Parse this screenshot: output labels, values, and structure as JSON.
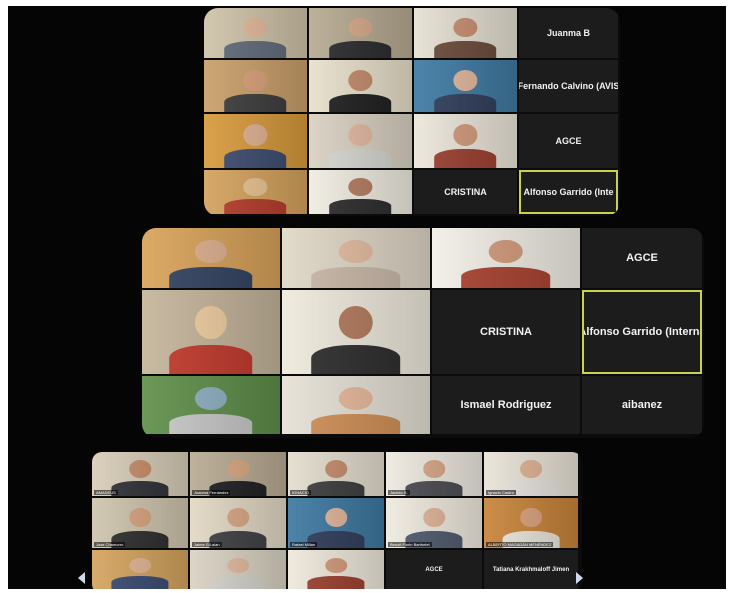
{
  "panels": [
    {
      "tiles": [
        {
          "kind": "video",
          "bg": "#cfc3a9",
          "skin": "#e2b89a",
          "shirt": "#5f6a78"
        },
        {
          "kind": "video",
          "bg": "#b7aa92",
          "skin": "#d6a888",
          "shirt": "#2a2a2e"
        },
        {
          "kind": "video",
          "bg": "#e5e0d2",
          "skin": "#c88e70",
          "shirt": "#6b4a3a"
        },
        {
          "kind": "name",
          "label": "Juanma B"
        },
        {
          "kind": "video",
          "bg": "#c99f6a",
          "skin": "#d9a07a",
          "shirt": "#3b3b3b"
        },
        {
          "kind": "video",
          "bg": "#e8e0cc",
          "skin": "#c48a6a",
          "shirt": "#1e1e1e"
        },
        {
          "kind": "video",
          "bg": "#3f7aa3",
          "skin": "#e0b59a",
          "shirt": "#2f3d5a"
        },
        {
          "kind": "name",
          "label": "Fernando Calvino (AVIS"
        },
        {
          "kind": "video",
          "bg": "#d79a3c",
          "skin": "#e0b090",
          "shirt": "#3c4a6e"
        },
        {
          "kind": "video",
          "bg": "#d9d1c2",
          "skin": "#e2b99e",
          "shirt": "#d7d7d0"
        },
        {
          "kind": "video",
          "bg": "#ece6da",
          "skin": "#d29a7a",
          "shirt": "#9a3e2e"
        },
        {
          "kind": "name",
          "label": "AGCE"
        },
        {
          "kind": "video",
          "bg": "#d4a25d",
          "skin": "#e6c28e",
          "shirt": "#b33a2a"
        },
        {
          "kind": "video",
          "bg": "#f0ece2",
          "skin": "#b47b5e",
          "shirt": "#2b2b2b"
        },
        {
          "kind": "name",
          "label": "CRISTINA"
        },
        {
          "kind": "name",
          "label": "Alfonso Garrido (Inte",
          "active": true
        }
      ]
    },
    {
      "tiles": [
        {
          "kind": "video",
          "bg": "#d9a35a",
          "skin": "#e0b090",
          "shirt": "#324260"
        },
        {
          "kind": "video",
          "bg": "#e0d7c6",
          "skin": "#e4bca0",
          "shirt": "#c9b8a8"
        },
        {
          "kind": "video",
          "bg": "#f2efe7",
          "skin": "#d39b7c",
          "shirt": "#a8412f"
        },
        {
          "kind": "name",
          "label": "AGCE"
        },
        {
          "kind": "video",
          "bg": "#c5b59b",
          "skin": "#f0cfa0",
          "shirt": "#c2392c"
        },
        {
          "kind": "video",
          "bg": "#efeadd",
          "skin": "#b27a5c",
          "shirt": "#2c2c2c"
        },
        {
          "kind": "name",
          "label": "CRISTINA"
        },
        {
          "kind": "name",
          "label": "Alfonso Garrido (Interna",
          "active": true
        },
        {
          "kind": "video",
          "bg": "#5f8f4a",
          "skin": "#8fb0c2",
          "shirt": "#c8c8c8"
        },
        {
          "kind": "video",
          "bg": "#e6e1d6",
          "skin": "#e7b89a",
          "shirt": "#cf8e55"
        },
        {
          "kind": "name",
          "label": "Ismael Rodriguez"
        },
        {
          "kind": "name",
          "label": "aibanez"
        }
      ]
    },
    {
      "tiles": [
        {
          "kind": "video",
          "bg": "#d8cdb8",
          "skin": "#c88d6a",
          "shirt": "#2f3138",
          "caption": "AMADEUS"
        },
        {
          "kind": "video",
          "bg": "#b9ab93",
          "skin": "#d8a680",
          "shirt": "#1e1e22",
          "caption": "Juanma Fernández"
        },
        {
          "kind": "video",
          "bg": "#e4decf",
          "skin": "#c78d6e",
          "shirt": "#3d3d3d",
          "caption": "IGNACIO"
        },
        {
          "kind": "video",
          "bg": "#eeeae1",
          "skin": "#d9a887",
          "shirt": "#4a4a52",
          "caption": "Jacinto S."
        },
        {
          "kind": "video",
          "bg": "#e9e3d7",
          "skin": "#ddb394",
          "shirt": "#e7e4df",
          "caption": "Ignacio Castro"
        },
        {
          "kind": "video",
          "bg": "#cfc5ae",
          "skin": "#d9a47e",
          "shirt": "#2d2d2d",
          "caption": "Jose Chamorro"
        },
        {
          "kind": "video",
          "bg": "#e2d8c4",
          "skin": "#d8a684",
          "shirt": "#3e3f43",
          "caption": "Jaime Gil-alan"
        },
        {
          "kind": "video",
          "bg": "#3e79a1",
          "skin": "#e0b59a",
          "shirt": "#2f3d5a",
          "caption": "Rafael Millan"
        },
        {
          "kind": "video",
          "bg": "#f0ebe0",
          "skin": "#e2b698",
          "shirt": "#4e5a6e",
          "caption": "Benoit Florin Barthelet"
        },
        {
          "kind": "video",
          "bg": "#c8843a",
          "skin": "#d9a07a",
          "shirt": "#e8e4da",
          "caption": "ALBERTO MAGADÁN MENÉNDEZ"
        },
        {
          "kind": "video",
          "bg": "#d4a45e",
          "skin": "#e0b592",
          "shirt": "#394a70"
        },
        {
          "kind": "video",
          "bg": "#dad2c3",
          "skin": "#e2b99e",
          "shirt": "#d5d3cc"
        },
        {
          "kind": "video",
          "bg": "#efe9dc",
          "skin": "#d29a7a",
          "shirt": "#9b3f2f"
        },
        {
          "kind": "name",
          "label": "AGCE"
        },
        {
          "kind": "name",
          "label": "Tatiana Krakhmaloff Jimen"
        }
      ]
    }
  ]
}
